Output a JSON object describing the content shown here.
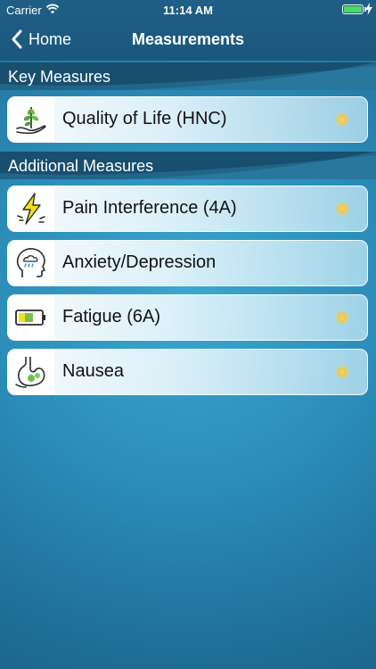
{
  "status": {
    "carrier": "Carrier",
    "time": "11:14 AM"
  },
  "nav": {
    "back_label": "Home",
    "title": "Measurements"
  },
  "sections": {
    "key": "Key Measures",
    "additional": "Additional Measures"
  },
  "items": [
    {
      "label": "Quality of Life (HNC)",
      "icon": "leaves-hand-icon",
      "status": "pending"
    },
    {
      "label": "Pain Interference (4A)",
      "icon": "lightning-pain-icon",
      "status": "pending"
    },
    {
      "label": "Anxiety/Depression",
      "icon": "head-cloud-icon",
      "status": "none"
    },
    {
      "label": "Fatigue (6A)",
      "icon": "low-battery-icon",
      "status": "pending"
    },
    {
      "label": "Nausea",
      "icon": "stomach-icon",
      "status": "pending"
    }
  ],
  "colors": {
    "indicator": "#e9c956",
    "section_bg": "#184e6e",
    "nav_bg": "#1f5f86"
  }
}
